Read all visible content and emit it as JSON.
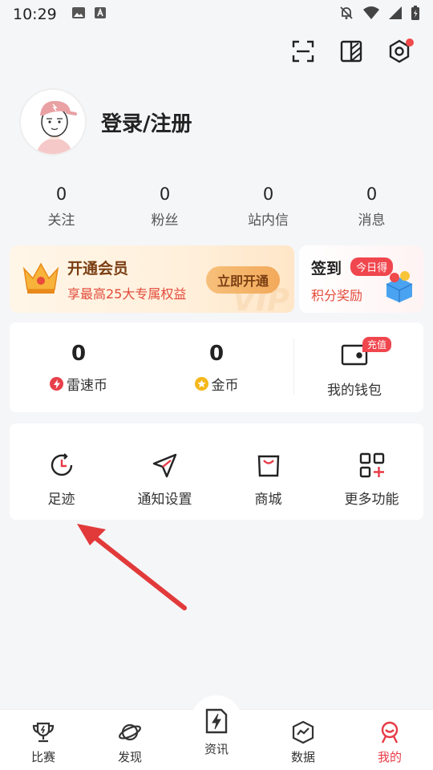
{
  "status_bar": {
    "time": "10:29"
  },
  "profile": {
    "login_text": "登录/注册"
  },
  "stats": [
    {
      "value": "0",
      "label": "关注"
    },
    {
      "value": "0",
      "label": "粉丝"
    },
    {
      "value": "0",
      "label": "站内信"
    },
    {
      "value": "0",
      "label": "消息"
    }
  ],
  "vip": {
    "title": "开通会员",
    "subtitle": "享最高25大专属权益",
    "button": "立即开通",
    "watermark": "VIP"
  },
  "signin": {
    "title": "签到",
    "badge": "今日得",
    "subtitle": "积分奖励"
  },
  "wallet": {
    "thunder_coin": {
      "value": "0",
      "label": "雷速币"
    },
    "gold_coin": {
      "value": "0",
      "label": "金币"
    },
    "my_wallet": {
      "label": "我的钱包",
      "badge": "充值"
    }
  },
  "functions": [
    {
      "label": "足迹",
      "icon": "history-clock-icon"
    },
    {
      "label": "通知设置",
      "icon": "paper-plane-icon"
    },
    {
      "label": "商城",
      "icon": "shopping-bag-icon"
    },
    {
      "label": "更多功能",
      "icon": "grid-plus-icon"
    }
  ],
  "tabs": [
    {
      "label": "比赛",
      "icon": "trophy-icon",
      "active": false
    },
    {
      "label": "发现",
      "icon": "planet-icon",
      "active": false
    },
    {
      "label": "资讯",
      "icon": "lightning-doc-icon",
      "active": false
    },
    {
      "label": "数据",
      "icon": "chart-shield-icon",
      "active": false
    },
    {
      "label": "我的",
      "icon": "user-smile-icon",
      "active": true
    }
  ],
  "colors": {
    "accent": "#e83a46",
    "vip_text": "#7a3e12",
    "background": "#f5f6f8"
  }
}
